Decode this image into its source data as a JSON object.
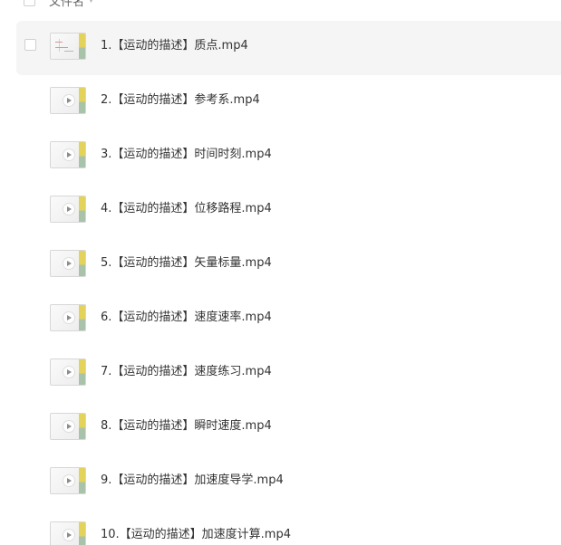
{
  "header": {
    "column_label": "文件名",
    "sort_icon": "sort-caret-down-icon"
  },
  "files": [
    {
      "name": "1.【运动的描述】质点.mp4",
      "selected": true
    },
    {
      "name": "2.【运动的描述】参考系.mp4",
      "selected": false
    },
    {
      "name": "3.【运动的描述】时间时刻.mp4",
      "selected": false
    },
    {
      "name": "4.【运动的描述】位移路程.mp4",
      "selected": false
    },
    {
      "name": "5.【运动的描述】矢量标量.mp4",
      "selected": false
    },
    {
      "name": "6.【运动的描述】速度速率.mp4",
      "selected": false
    },
    {
      "name": "7.【运动的描述】速度练习.mp4",
      "selected": false
    },
    {
      "name": "8.【运动的描述】瞬时速度.mp4",
      "selected": false
    },
    {
      "name": "9.【运动的描述】加速度导学.mp4",
      "selected": false
    },
    {
      "name": "10.【运动的描述】加速度计算.mp4",
      "selected": false
    }
  ],
  "colors": {
    "selected_row_background": "#f5f5f5",
    "text": "#333333",
    "thumbnail_accent": "#e4d35a"
  }
}
